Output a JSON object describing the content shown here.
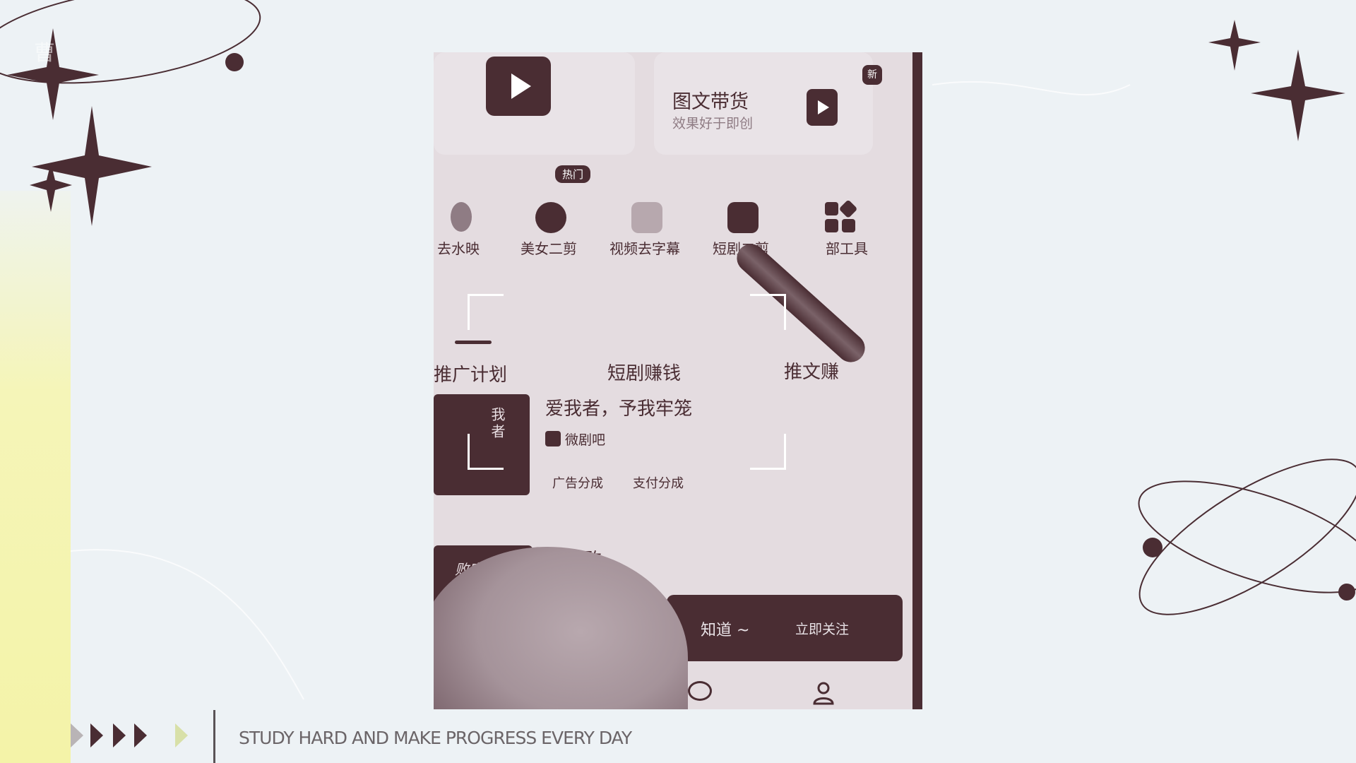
{
  "watermark": {
    "text": "曹"
  },
  "phone": {
    "top_cards": {
      "tuwen_title": "图文带货",
      "tuwen_subtitle": "效果好于即创",
      "new_badge": "新"
    },
    "tools": [
      {
        "label": "去水映"
      },
      {
        "label": "美女二剪"
      },
      {
        "label": "视频去字幕"
      },
      {
        "label": "短剧二剪"
      },
      {
        "label": "部工具"
      }
    ],
    "hot_badge": "热门",
    "tabs": [
      {
        "label": "推广计划"
      },
      {
        "label": "短剧赚钱"
      },
      {
        "label": "推文赚"
      }
    ],
    "drama1": {
      "title": "爱我者，予我牢笼",
      "poster_text": "我者",
      "app": "微剧吧",
      "tags": [
        "广告分成",
        "支付分成"
      ]
    },
    "drama2": {
      "title": "大梁败",
      "poster_text": "败家子"
    },
    "follow_bar": {
      "text": "知道 ~",
      "button": "立即关注"
    }
  },
  "footer": {
    "slogan": "STUDY HARD AND MAKE PROGRESS EVERY DAY"
  },
  "colors": {
    "background": "#edf2f5",
    "yellow_band": "#f4f3a8",
    "dark_accent": "#4a2d33",
    "phone_bg": "#e4dce0"
  }
}
